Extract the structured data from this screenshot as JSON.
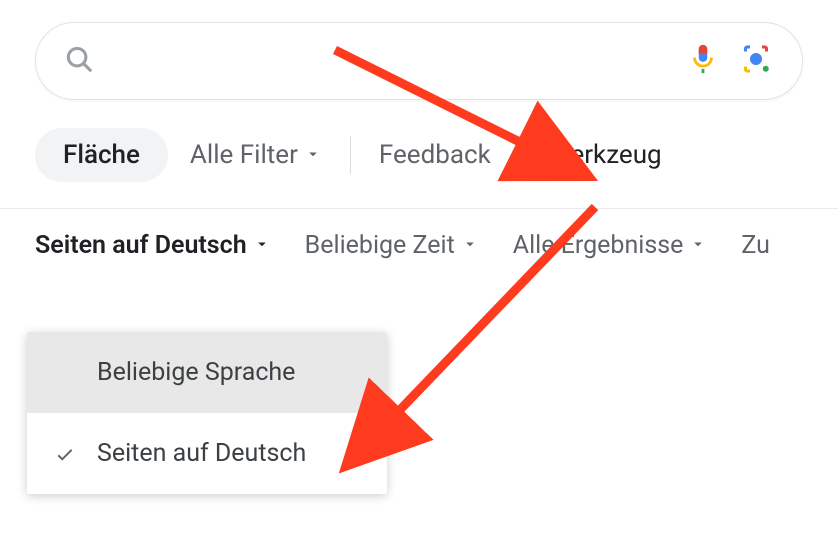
{
  "search": {
    "placeholder": ""
  },
  "tabs": {
    "area": "Fläche",
    "allFilters": "Alle Filter",
    "feedback": "Feedback",
    "tools": "Werkzeug"
  },
  "tools": {
    "language": "Seiten auf Deutsch",
    "time": "Beliebige Zeit",
    "results": "Alle Ergebnisse",
    "last": "Zu"
  },
  "dropdown": {
    "anyLanguage": "Beliebige Sprache",
    "germanPages": "Seiten auf Deutsch"
  }
}
